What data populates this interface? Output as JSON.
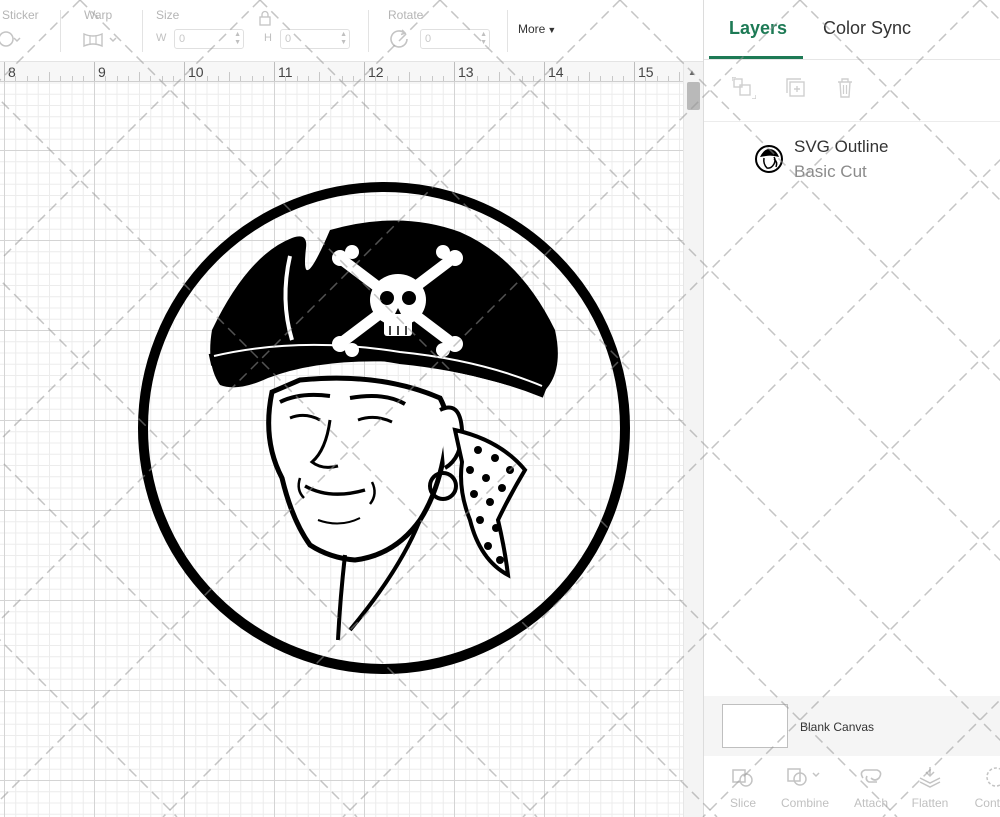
{
  "toolbar": {
    "sticker_label": "Sticker",
    "warp_label": "Warp",
    "size_label": "Size",
    "width_letter": "W",
    "width_value": "0",
    "height_letter": "H",
    "height_value": "0",
    "rotate_label": "Rotate",
    "rotate_value": "0",
    "more_label": "More"
  },
  "ruler": {
    "labels": [
      "8",
      "9",
      "10",
      "11",
      "12",
      "13",
      "14",
      "15"
    ]
  },
  "panel": {
    "tabs": [
      {
        "label": "Layers",
        "active": true
      },
      {
        "label": "Color Sync",
        "active": false
      }
    ],
    "layers": [
      {
        "name": "SVG Outline",
        "operation": "Basic Cut",
        "icon": "pirate-logo-thumbnail"
      }
    ],
    "blank_canvas_label": "Blank Canvas",
    "actions": [
      {
        "label": "Slice",
        "icon": "slice-icon"
      },
      {
        "label": "Combine",
        "icon": "combine-icon"
      },
      {
        "label": "Attach",
        "icon": "attach-icon"
      },
      {
        "label": "Flatten",
        "icon": "flatten-icon"
      },
      {
        "label": "Contour",
        "icon": "contour-icon"
      }
    ]
  },
  "colors": {
    "accent": "#1d7a55",
    "grid_major": "#d4d4d4",
    "grid_minor": "#ececec"
  }
}
